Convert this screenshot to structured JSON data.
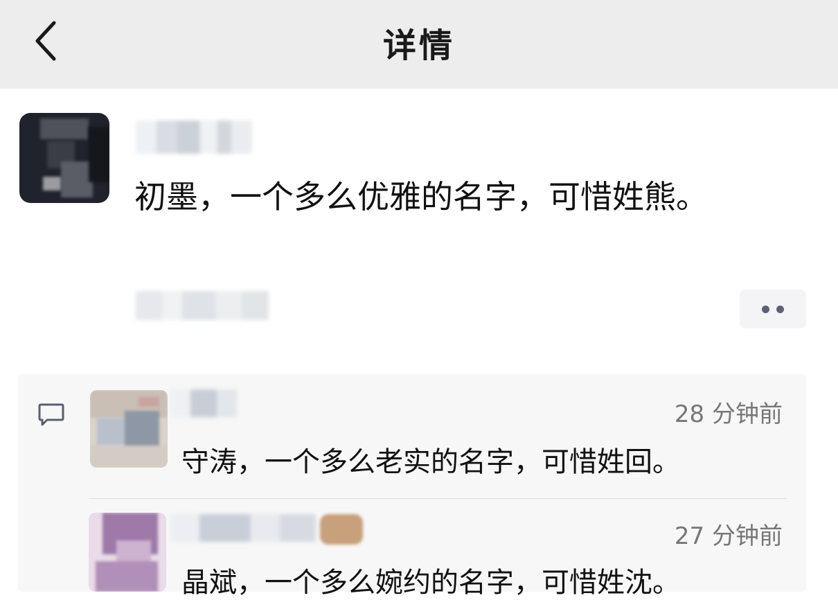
{
  "nav": {
    "title": "详情",
    "back_icon": "chevron-left-icon"
  },
  "post": {
    "text": "初墨，一个多么优雅的名字，可惜姓熊。",
    "more_icon": "more-dots-icon"
  },
  "comments": [
    {
      "time": "28 分钟前",
      "text": "守涛，一个多么老实的名字，可惜姓回。"
    },
    {
      "time": "27 分钟前",
      "text": "晶斌，一个多么婉约的名字，可惜姓沈。"
    }
  ],
  "icons": {
    "comment": "comment-bubble-icon"
  }
}
